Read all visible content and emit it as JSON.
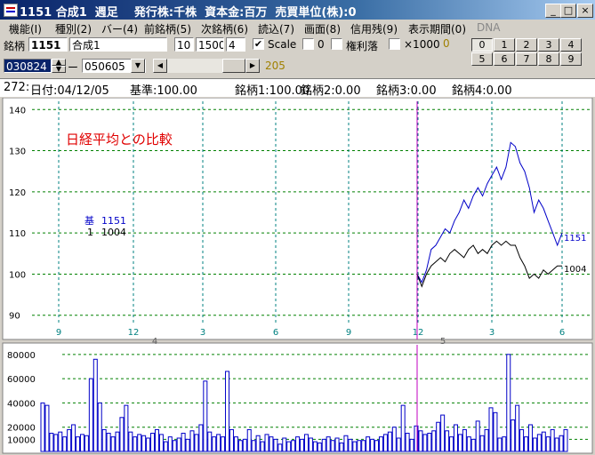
{
  "window": {
    "title": "1151 合成1  週足    発行株:千株  資本金:百万  売買単位(株):0"
  },
  "menu": [
    "機能(I)",
    "種別(2)",
    "バー(4)",
    "前銘柄(5)",
    "次銘柄(6)",
    "読込(7)",
    "画面(8)",
    "信用残(9)",
    "表示期間(0)",
    "DNA"
  ],
  "toolbar": {
    "meigara_label": "銘柄",
    "code": "1151",
    "name": "合成1",
    "param1": "10",
    "param2": "1500",
    "param3": "4",
    "scale_label": "Scale",
    "scale_checked": "✔",
    "zero_label": "0",
    "kenri_label": "権利落",
    "x1000_label": "×1000",
    "x1000_value": "0",
    "date_from": "030824",
    "date_dash": "ー",
    "date_to": "050605",
    "scroll_value": "205",
    "num_buttons": [
      "0",
      "1",
      "2",
      "3",
      "4",
      "5",
      "6",
      "7",
      "8",
      "9"
    ]
  },
  "info": {
    "record": "272:",
    "date": "日付:04/12/05",
    "base": "基準:100.00",
    "m1": "銘柄1:100.00",
    "m2": "銘柄2:0.00",
    "m3": "銘柄3:0.00",
    "m4": "銘柄4:0.00"
  },
  "colors": {
    "series_1151": "#0000c8",
    "series_1004": "#000000",
    "annotation": "#e00000",
    "cursor": "#c000c0",
    "grid_x": "#008080",
    "grid_y": "#008000"
  },
  "chart_data": [
    {
      "type": "line",
      "title": "日経平均との比較",
      "legend": [
        {
          "marker": "基",
          "name": "1151"
        },
        {
          "marker": "1",
          "name": "1004"
        }
      ],
      "x_tick_labels": [
        "9",
        "12",
        "3",
        "6",
        "9",
        "12",
        "3",
        "6"
      ],
      "year_labels": [
        "4",
        "5"
      ],
      "ylim": [
        88,
        142
      ],
      "y_ticks": [
        90,
        100,
        110,
        120,
        130,
        140
      ],
      "series": [
        {
          "name": "1151",
          "end_label": "1151",
          "values": [
            100,
            98,
            101,
            106,
            107,
            109,
            111,
            110,
            113,
            115,
            118,
            116,
            119,
            121,
            119,
            122,
            124,
            126,
            123,
            126,
            132,
            131,
            127,
            125,
            121,
            115,
            118,
            116,
            113,
            110,
            107,
            110
          ]
        },
        {
          "name": "1004",
          "end_label": "1004",
          "values": [
            100,
            97,
            100,
            102,
            103,
            104,
            103,
            105,
            106,
            105,
            104,
            106,
            107,
            105,
            106,
            105,
            107,
            108,
            107,
            108,
            107,
            107,
            104,
            102,
            99,
            100,
            99,
            101,
            100,
            101,
            102,
            102
          ]
        }
      ]
    },
    {
      "type": "bar",
      "ylim": [
        0,
        85000
      ],
      "y_ticks": [
        10000,
        20000,
        40000,
        60000,
        80000
      ],
      "values": [
        40000,
        38000,
        15000,
        14000,
        16000,
        12000,
        18000,
        22000,
        12000,
        14000,
        13000,
        60000,
        76000,
        40000,
        18000,
        15000,
        12000,
        16000,
        28000,
        38000,
        16000,
        12000,
        14000,
        13000,
        11000,
        15000,
        18000,
        14000,
        8000,
        12000,
        9000,
        11000,
        15000,
        10000,
        17000,
        14000,
        22000,
        58000,
        16000,
        12000,
        14000,
        12000,
        66000,
        18000,
        12000,
        9000,
        10000,
        18000,
        9000,
        13000,
        8000,
        14000,
        12000,
        10000,
        6000,
        11000,
        8000,
        9000,
        12000,
        10000,
        14000,
        11000,
        8000,
        7000,
        10000,
        12000,
        9000,
        11000,
        7000,
        13000,
        10000,
        8000,
        9000,
        9000,
        12000,
        10000,
        9000,
        12000,
        14000,
        16000,
        20000,
        11000,
        38000,
        15000,
        10000,
        21000,
        17000,
        14000,
        15000,
        17000,
        24000,
        30000,
        17000,
        12000,
        22000,
        14000,
        18000,
        12000,
        10000,
        25000,
        13000,
        18000,
        36000,
        32000,
        11000,
        12000,
        80000,
        26000,
        38000,
        18000,
        12000,
        22000,
        11000,
        14000,
        16000,
        12000,
        18000,
        11000,
        13000,
        18000
      ]
    }
  ]
}
